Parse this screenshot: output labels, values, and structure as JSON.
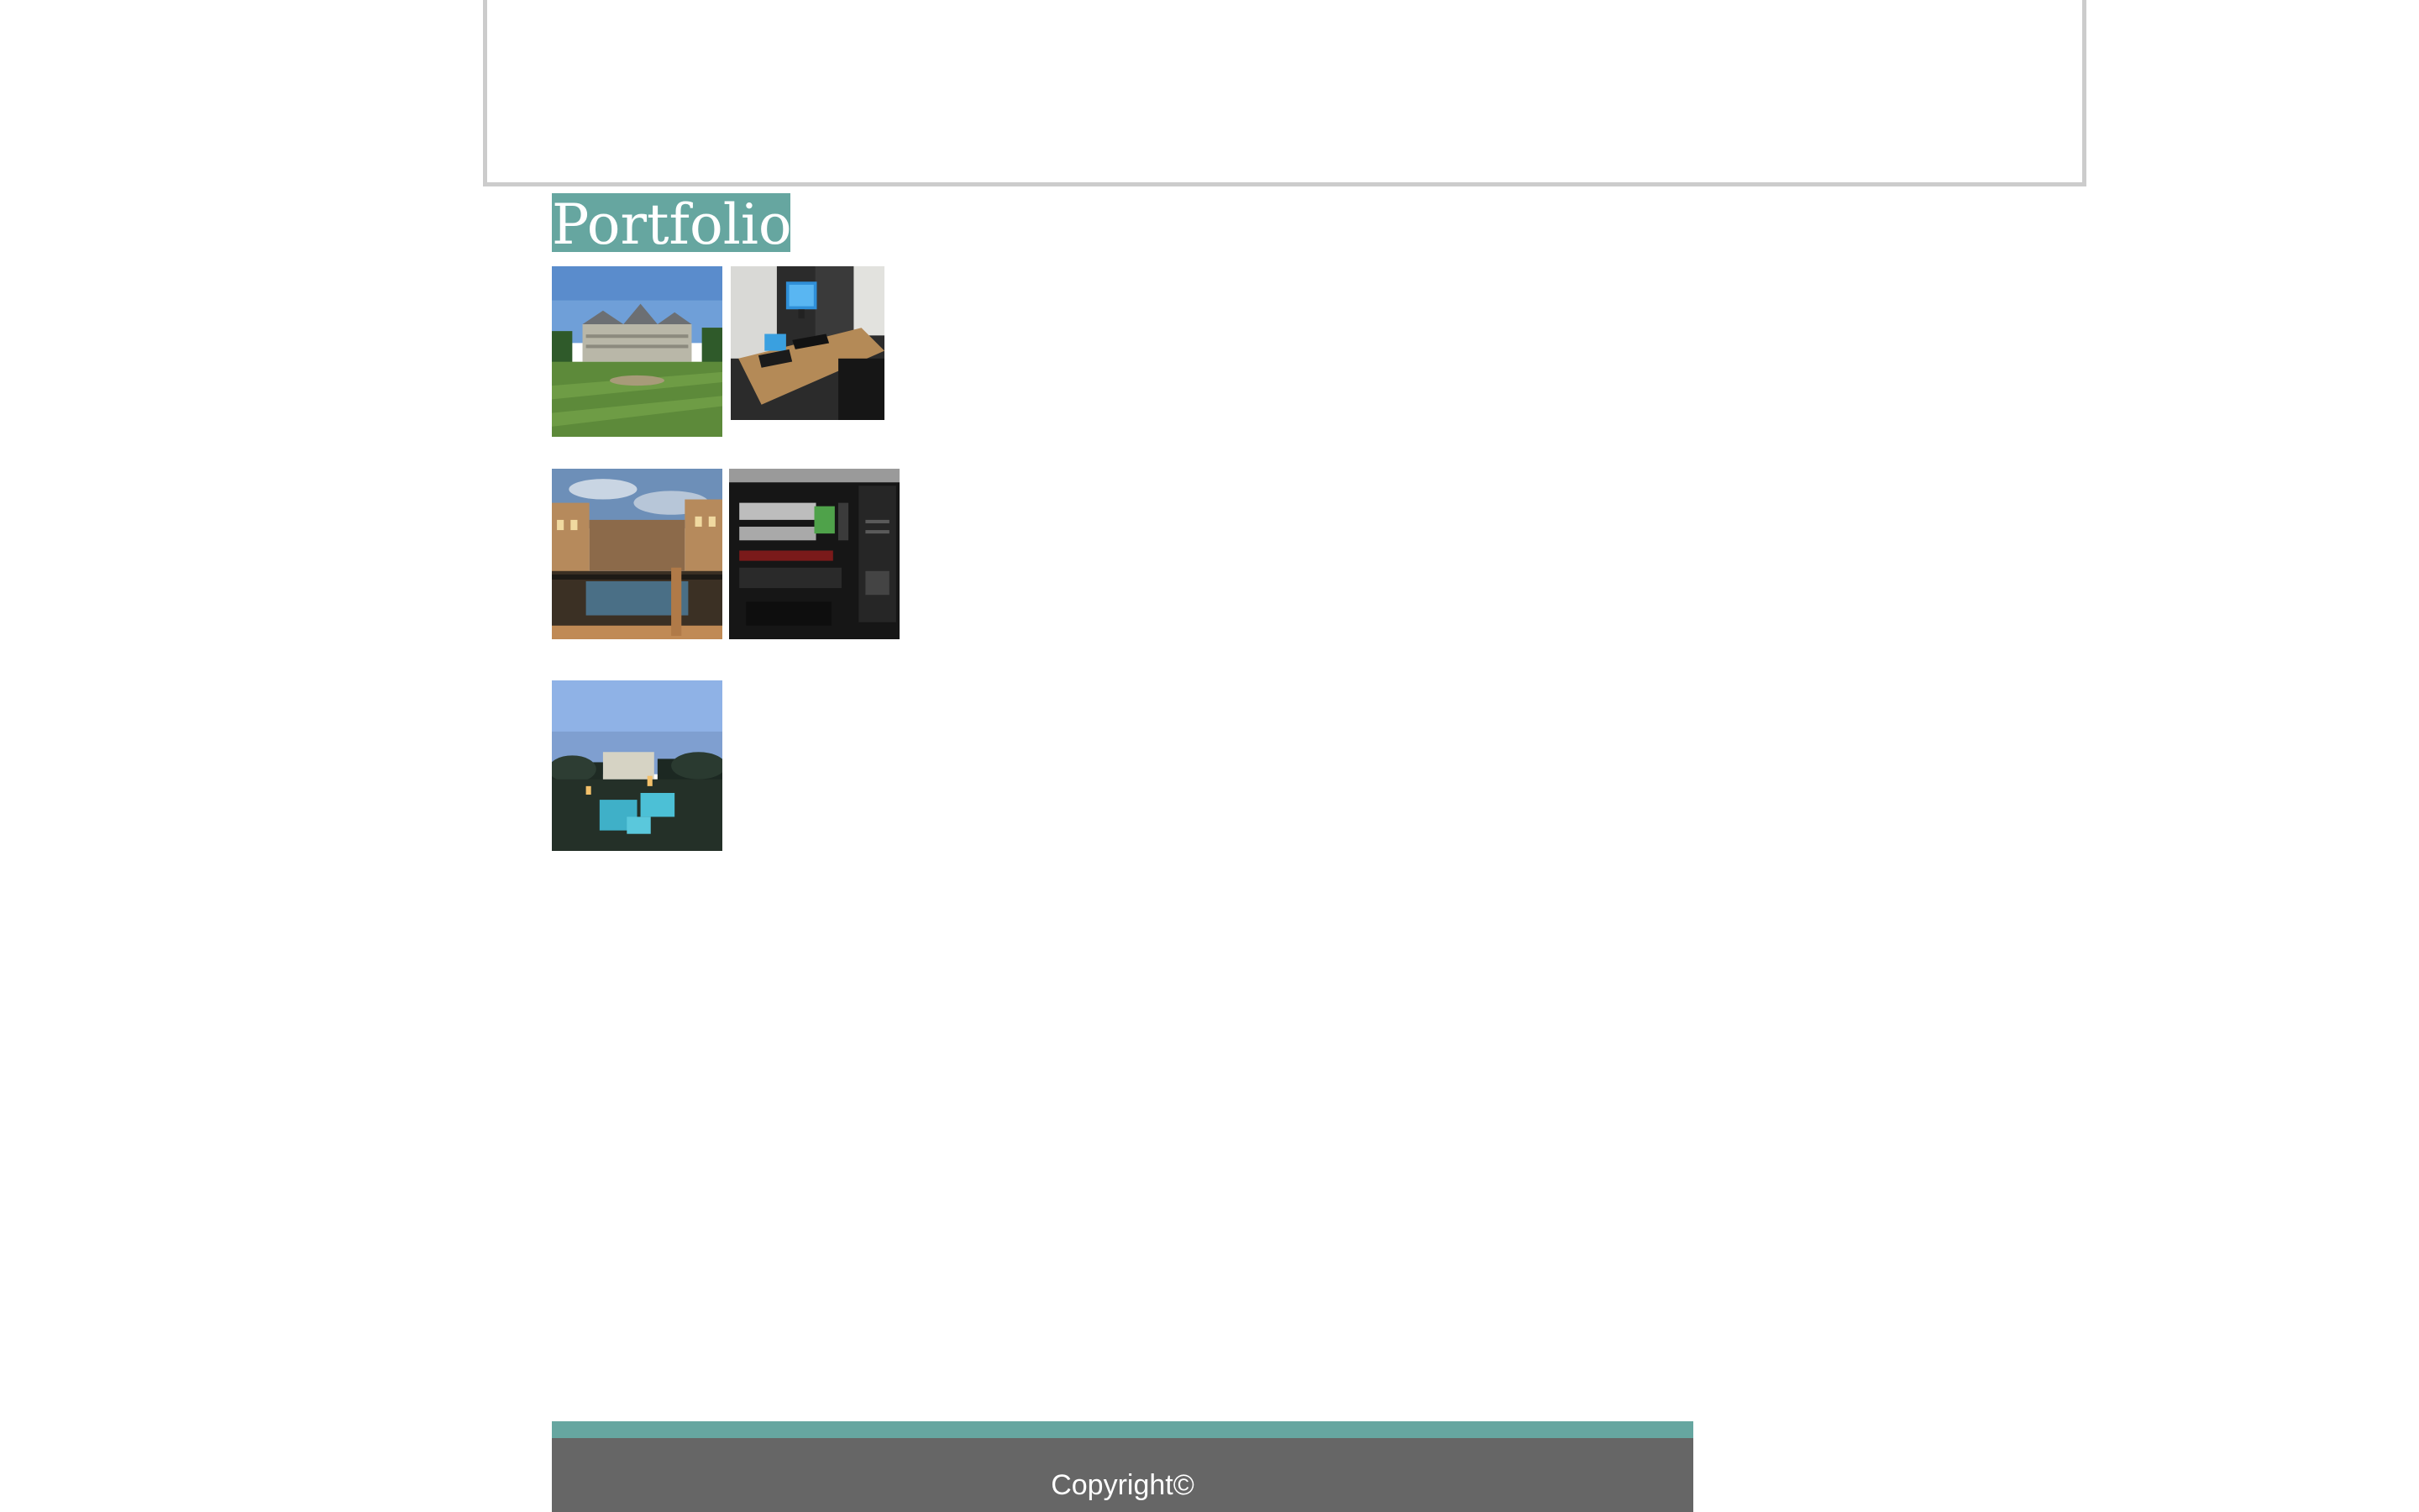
{
  "portfolio": {
    "title": "Portfolio",
    "images": [
      {
        "subject": "Mansion with lawn under blue sky"
      },
      {
        "subject": "Computer desk with monitor and laptop"
      },
      {
        "subject": "Indoor canal with painted sky ceiling"
      },
      {
        "subject": "Open computer case with components"
      },
      {
        "subject": "Resort pool at dusk with palm trees"
      }
    ]
  },
  "footer": {
    "copyright": "Copyright©"
  },
  "colors": {
    "accent": "#66a6a0",
    "footer_bg": "#666666",
    "header_border": "#cccccc"
  }
}
